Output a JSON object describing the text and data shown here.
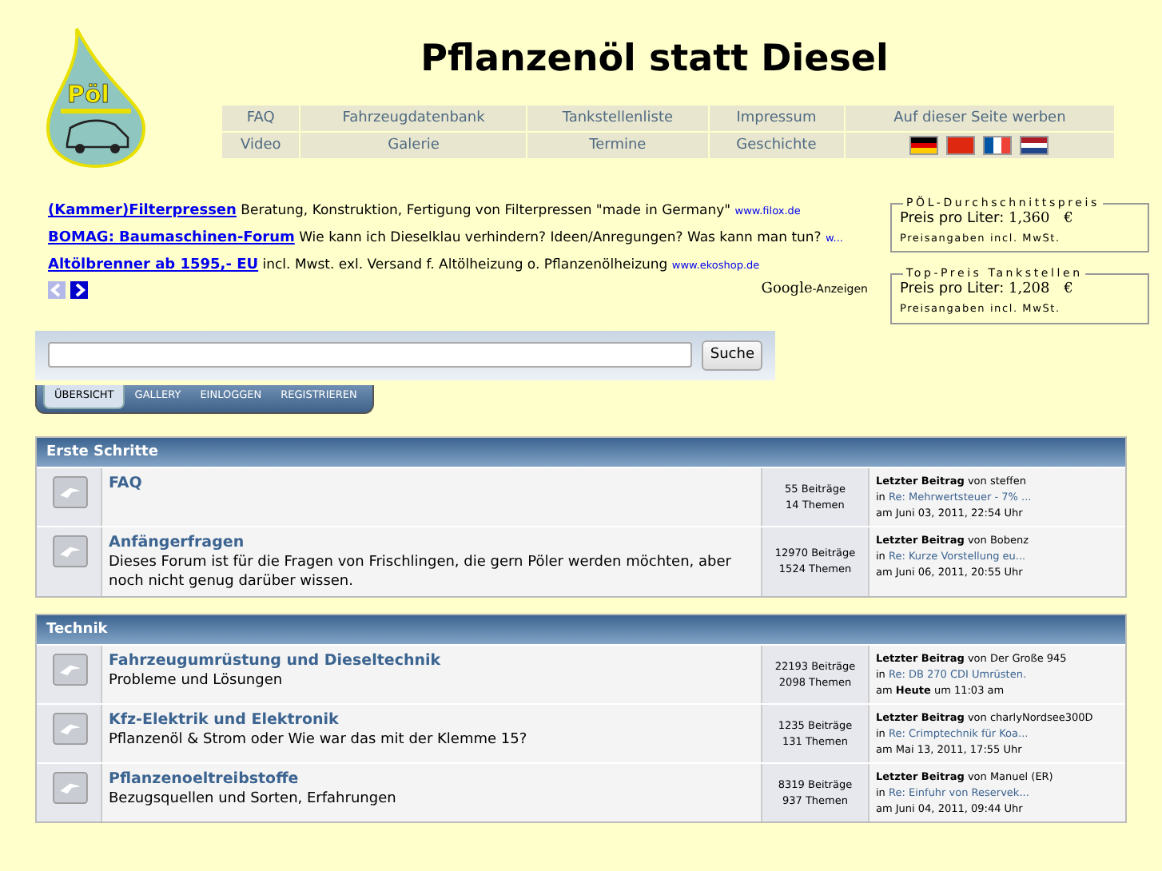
{
  "logo": {
    "text": "Pöl"
  },
  "site_title": "Pflanzenöl statt Diesel",
  "nav": [
    [
      "FAQ",
      "Fahrzeugdatenbank",
      "Tankstellenliste",
      "Impressum",
      "Auf dieser Seite werben"
    ],
    [
      "Video",
      "Galerie",
      "Termine",
      "Geschichte"
    ]
  ],
  "ads": [
    {
      "link": "(Kammer)Filterpressen",
      "text": "Beratung, Konstruktion, Fertigung von Filterpressen \"made in Germany\"",
      "domain": "www.filox.de"
    },
    {
      "link": "BOMAG: Baumaschinen-Forum",
      "text": "Wie kann ich Dieselklau verhindern? Ideen/Anregungen? Was kann man tun?",
      "domain": "w..."
    },
    {
      "link": "Altölbrenner ab 1595,- EU",
      "text": "incl. Mwst. exl. Versand f. Altölheizung o. Pflanzenölheizung",
      "domain": "www.ekoshop.de"
    }
  ],
  "ad_label": {
    "brand": "Google",
    "suffix": "-Anzeigen"
  },
  "price_boxes": [
    {
      "title": "PÖL-Durchschnittspreis",
      "label": "Preis pro Liter:",
      "price": "1,360",
      "currency": "€",
      "note": "Preisangaben incl. MwSt."
    },
    {
      "title": "Top-Preis Tankstellen",
      "label": "Preis pro Liter:",
      "price": "1,208",
      "currency": "€",
      "note": "Preisangaben incl. MwSt."
    }
  ],
  "search": {
    "button": "Suche"
  },
  "tabs": [
    {
      "label": "ÜBERSICHT",
      "selected": true
    },
    {
      "label": "GALLERY",
      "selected": false
    },
    {
      "label": "EINLOGGEN",
      "selected": false
    },
    {
      "label": "REGISTRIEREN",
      "selected": false
    }
  ],
  "categories": [
    {
      "title": "Erste Schritte",
      "boards": [
        {
          "name": "FAQ",
          "posts": "55 Beiträge",
          "topics": "14 Themen",
          "last_by": "**Letzter Beitrag** von steffen",
          "last_in": "in",
          "last_topic": "Re: Mehrwertsteuer - 7% ...",
          "last_date": "am Juni 03, 2011, 22:54 Uhr"
        },
        {
          "name": "Anfängerfragen",
          "description": "Dieses Forum ist für die Fragen von Frischlingen, die gern Pöler werden möchten, aber noch nicht genug darüber wissen.",
          "posts": "12970 Beiträge",
          "topics": "1524 Themen",
          "last_by": "**Letzter Beitrag** von Bobenz",
          "last_in": "in",
          "last_topic": "Re: Kurze Vorstellung eu...",
          "last_date": "am Juni 06, 2011, 20:55 Uhr"
        }
      ]
    },
    {
      "title": "Technik",
      "boards": [
        {
          "name": "Fahrzeugumrüstung und Dieseltechnik",
          "description": "Probleme und Lösungen",
          "posts": "22193 Beiträge",
          "topics": "2098 Themen",
          "last_by": "**Letzter Beitrag** von Der Große 945",
          "last_in": "in",
          "last_topic": "Re: DB 270 CDI Umrüsten.",
          "last_date": "am **Heute** um 11:03 am"
        },
        {
          "name": "Kfz-Elektrik und Elektronik",
          "description": "Pflanzenöl & Strom oder Wie war das mit der Klemme 15?",
          "posts": "1235 Beiträge",
          "topics": "131 Themen",
          "last_by": "**Letzter Beitrag** von charlyNordsee300D",
          "last_in": "in",
          "last_topic": "Re: Crimptechnik für Koa...",
          "last_date": "am Mai 13, 2011, 17:55 Uhr"
        },
        {
          "name": "Pflanzenoeltreibstoffe",
          "description": "Bezugsquellen und Sorten, Erfahrungen",
          "posts": "8319 Beiträge",
          "topics": "937 Themen",
          "last_by": "**Letzter Beitrag** von Manuel (ER)",
          "last_in": "in",
          "last_topic": "Re: Einfuhr von Reservek...",
          "last_date": "am Juni 04, 2011, 09:44 Uhr"
        }
      ]
    }
  ]
}
